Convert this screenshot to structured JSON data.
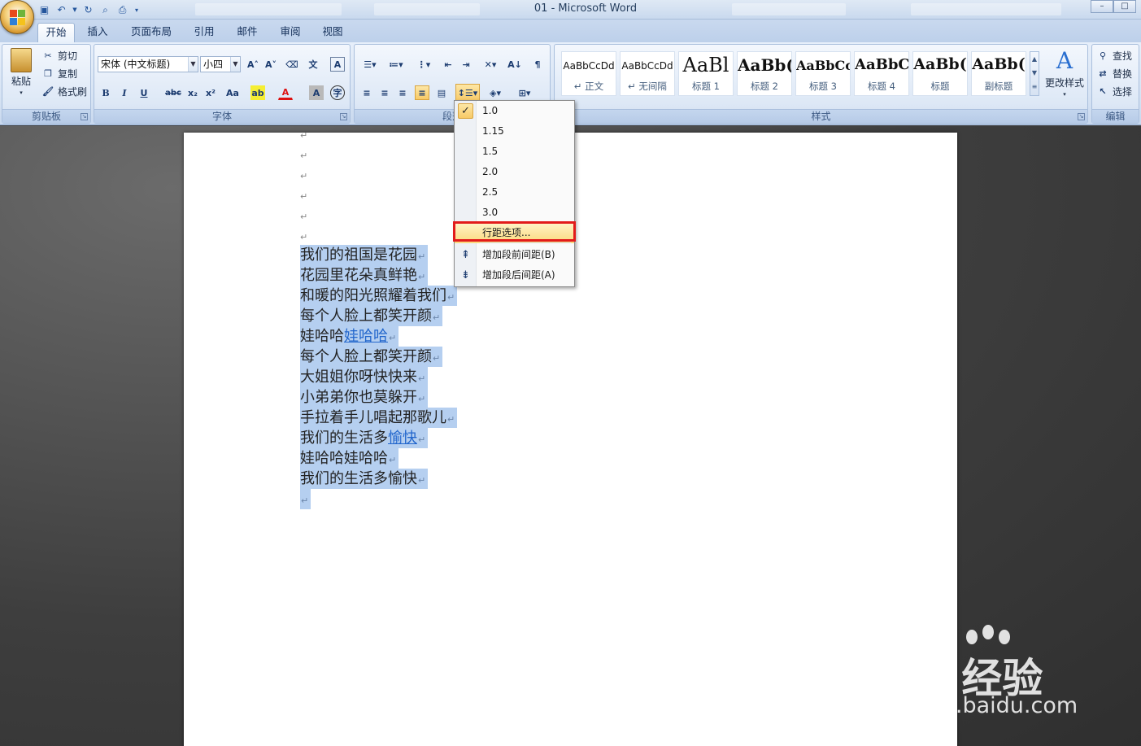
{
  "window": {
    "title": "01 - Microsoft Word"
  },
  "ribbon": {
    "tabs": [
      "开始",
      "插入",
      "页面布局",
      "引用",
      "邮件",
      "审阅",
      "视图"
    ],
    "groups": {
      "clipboard": {
        "label": "剪贴板",
        "paste": "粘贴",
        "cut": "剪切",
        "copy": "复制",
        "format_painter": "格式刷"
      },
      "font": {
        "label": "字体",
        "font_name": "宋体 (中文标题)",
        "font_size": "小四"
      },
      "paragraph": {
        "label": "段落"
      },
      "styles": {
        "label": "样式",
        "change_styles": "更改样式",
        "gallery": [
          {
            "sample": "AaBbCcDd",
            "name": "↵ 正文"
          },
          {
            "sample": "AaBbCcDd",
            "name": "↵ 无间隔"
          },
          {
            "sample": "AaBl",
            "name": "标题 1"
          },
          {
            "sample": "AaBb(",
            "name": "标题 2"
          },
          {
            "sample": "AaBbCc",
            "name": "标题 3"
          },
          {
            "sample": "AaBbC",
            "name": "标题 4"
          },
          {
            "sample": "AaBb(",
            "name": "标题"
          },
          {
            "sample": "AaBb(",
            "name": "副标题"
          }
        ]
      },
      "editing": {
        "label": "编辑",
        "find": "查找",
        "replace": "替换",
        "select": "选择"
      }
    }
  },
  "line_spacing_menu": {
    "options": [
      "1.0",
      "1.15",
      "1.5",
      "2.0",
      "2.5",
      "3.0"
    ],
    "selected": "1.0",
    "line_spacing_options": "行距选项...",
    "add_space_before": "增加段前间距(B)",
    "add_space_after": "增加段后间距(A)"
  },
  "document": {
    "lines": [
      {
        "text": "我们的祖国是花园"
      },
      {
        "text": "花园里花朵真鲜艳"
      },
      {
        "text": "和暖的阳光照耀着我们"
      },
      {
        "text": "每个人脸上都笑开颜"
      },
      {
        "text": "娃哈哈",
        "link": "娃哈哈"
      },
      {
        "text": "每个人脸上都笑开颜"
      },
      {
        "text": "大姐姐你呀快快来"
      },
      {
        "text": "小弟弟你也莫躲开"
      },
      {
        "text": "手拉着手儿唱起那歌儿"
      },
      {
        "text": "我们的生活多",
        "link": "愉快"
      },
      {
        "text": "娃哈哈娃哈哈"
      },
      {
        "text": "我们的生活多愉快"
      }
    ],
    "paragraph_mark": "↵"
  },
  "watermark": {
    "brand": "Bai  经验",
    "url": "jingyan.baidu.com"
  },
  "colors": {
    "selection": "#b5cff0",
    "menu_highlight": "#fbd97c",
    "annotation_box": "#e21b1b"
  }
}
